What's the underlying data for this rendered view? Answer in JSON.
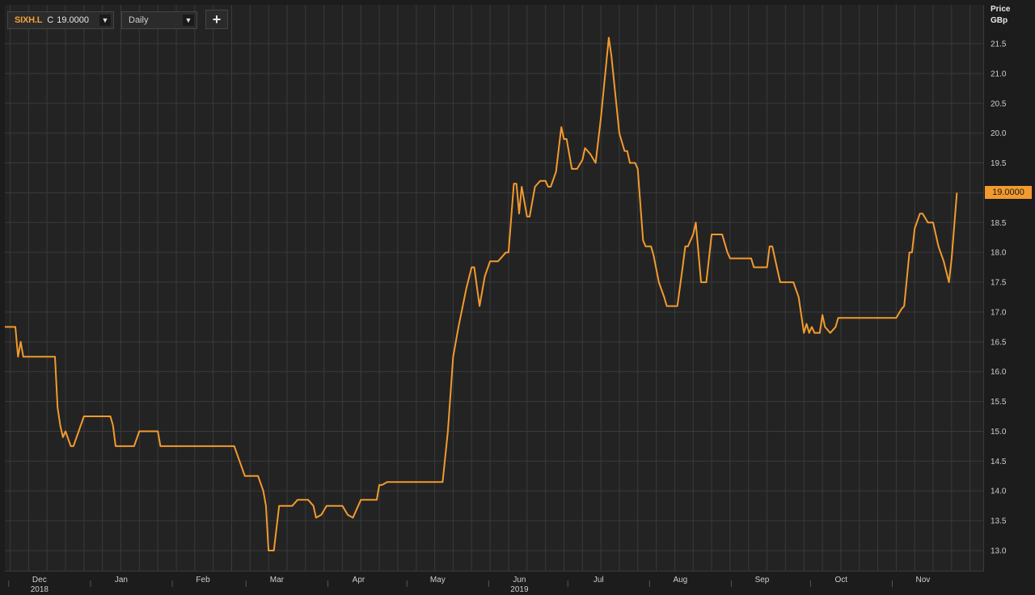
{
  "toolbar": {
    "ric": "SIXH.L",
    "close_prefix": "C",
    "close_value": "19.0000",
    "interval": "Daily",
    "add_label": "+"
  },
  "axis": {
    "title_line1": "Price",
    "title_line2": "GBp",
    "last_price_label": "19.0000"
  },
  "colors": {
    "line": "#f29a2e",
    "background": "#1c1c1c",
    "plot_background": "#232323",
    "grid": "#3a3a3a"
  },
  "icons": {
    "ric_dropdown": "triangle-down-icon",
    "interval_dropdown": "triangle-down-icon",
    "add": "plus-icon"
  },
  "chart_data": {
    "type": "line",
    "title": "",
    "xlabel": "",
    "ylabel": "Price GBp",
    "ylim": [
      12.7,
      22.1
    ],
    "yticks": [
      13.0,
      13.5,
      14.0,
      14.5,
      15.0,
      15.5,
      16.0,
      16.5,
      17.0,
      17.5,
      18.0,
      18.5,
      19.0,
      19.5,
      20.0,
      20.5,
      21.0,
      21.5
    ],
    "ytick_labels": [
      "13.0",
      "13.5",
      "14.0",
      "14.5",
      "15.0",
      "15.5",
      "16.0",
      "16.5",
      "17.0",
      "17.5",
      "18.0",
      "18.5",
      "19.0",
      "19.5",
      "20.0",
      "20.5",
      "21.0",
      "21.5"
    ],
    "x_start": "2018-11-24",
    "x_end": "2019-11-30",
    "grid": true,
    "month_labels": [
      {
        "label": "Dec",
        "date": "2018-12-01"
      },
      {
        "label": "Jan",
        "date": "2019-01-01"
      },
      {
        "label": "Feb",
        "date": "2019-02-01"
      },
      {
        "label": "Mar",
        "date": "2019-03-01"
      },
      {
        "label": "Apr",
        "date": "2019-04-01"
      },
      {
        "label": "May",
        "date": "2019-05-01"
      },
      {
        "label": "Jun",
        "date": "2019-06-01"
      },
      {
        "label": "Jul",
        "date": "2019-07-01"
      },
      {
        "label": "Aug",
        "date": "2019-08-01"
      },
      {
        "label": "Sep",
        "date": "2019-09-01"
      },
      {
        "label": "Oct",
        "date": "2019-10-01"
      },
      {
        "label": "Nov",
        "date": "2019-11-01"
      }
    ],
    "year_labels": [
      {
        "label": "2018",
        "date": "2018-12-01"
      },
      {
        "label": "2019",
        "date": "2019-06-01"
      }
    ],
    "series": [
      {
        "values": [
          [
            "2018-11-24",
            16.75
          ],
          [
            "2018-11-28",
            16.75
          ],
          [
            "2018-11-29",
            16.25
          ],
          [
            "2018-11-30",
            16.5
          ],
          [
            "2018-12-01",
            16.25
          ],
          [
            "2018-12-13",
            16.25
          ],
          [
            "2018-12-14",
            15.4
          ],
          [
            "2018-12-15",
            15.1
          ],
          [
            "2018-12-16",
            14.9
          ],
          [
            "2018-12-17",
            15.0
          ],
          [
            "2018-12-19",
            14.75
          ],
          [
            "2018-12-20",
            14.75
          ],
          [
            "2018-12-22",
            15.0
          ],
          [
            "2018-12-24",
            15.25
          ],
          [
            "2019-01-03",
            15.25
          ],
          [
            "2019-01-04",
            15.1
          ],
          [
            "2019-01-05",
            14.75
          ],
          [
            "2019-01-12",
            14.75
          ],
          [
            "2019-01-14",
            15.0
          ],
          [
            "2019-01-21",
            15.0
          ],
          [
            "2019-01-22",
            14.75
          ],
          [
            "2019-02-05",
            14.75
          ],
          [
            "2019-02-19",
            14.75
          ],
          [
            "2019-02-21",
            14.5
          ],
          [
            "2019-02-23",
            14.25
          ],
          [
            "2019-02-28",
            14.25
          ],
          [
            "2019-03-02",
            14.0
          ],
          [
            "2019-03-03",
            13.75
          ],
          [
            "2019-03-04",
            13.0
          ],
          [
            "2019-03-06",
            13.0
          ],
          [
            "2019-03-08",
            13.75
          ],
          [
            "2019-03-13",
            13.75
          ],
          [
            "2019-03-15",
            13.85
          ],
          [
            "2019-03-19",
            13.85
          ],
          [
            "2019-03-21",
            13.75
          ],
          [
            "2019-03-22",
            13.55
          ],
          [
            "2019-03-24",
            13.6
          ],
          [
            "2019-03-26",
            13.75
          ],
          [
            "2019-04-01",
            13.75
          ],
          [
            "2019-04-03",
            13.6
          ],
          [
            "2019-04-05",
            13.55
          ],
          [
            "2019-04-07",
            13.75
          ],
          [
            "2019-04-08",
            13.85
          ],
          [
            "2019-04-14",
            13.85
          ],
          [
            "2019-04-15",
            14.1
          ],
          [
            "2019-04-16",
            14.1
          ],
          [
            "2019-04-18",
            14.15
          ],
          [
            "2019-05-01",
            14.15
          ],
          [
            "2019-05-08",
            14.15
          ],
          [
            "2019-05-09",
            14.15
          ],
          [
            "2019-05-11",
            15.0
          ],
          [
            "2019-05-13",
            16.25
          ],
          [
            "2019-05-15",
            16.75
          ],
          [
            "2019-05-18",
            17.4
          ],
          [
            "2019-05-20",
            17.75
          ],
          [
            "2019-05-21",
            17.75
          ],
          [
            "2019-05-23",
            17.1
          ],
          [
            "2019-05-25",
            17.6
          ],
          [
            "2019-05-27",
            17.85
          ],
          [
            "2019-05-30",
            17.85
          ],
          [
            "2019-05-31",
            17.9
          ],
          [
            "2019-06-02",
            18.0
          ],
          [
            "2019-06-03",
            18.0
          ],
          [
            "2019-06-05",
            19.15
          ],
          [
            "2019-06-06",
            19.15
          ],
          [
            "2019-06-07",
            18.65
          ],
          [
            "2019-06-08",
            19.1
          ],
          [
            "2019-06-10",
            18.6
          ],
          [
            "2019-06-11",
            18.6
          ],
          [
            "2019-06-13",
            19.1
          ],
          [
            "2019-06-15",
            19.2
          ],
          [
            "2019-06-17",
            19.2
          ],
          [
            "2019-06-18",
            19.1
          ],
          [
            "2019-06-19",
            19.1
          ],
          [
            "2019-06-21",
            19.35
          ],
          [
            "2019-06-23",
            20.1
          ],
          [
            "2019-06-24",
            19.9
          ],
          [
            "2019-06-25",
            19.9
          ],
          [
            "2019-06-27",
            19.4
          ],
          [
            "2019-06-29",
            19.4
          ],
          [
            "2019-07-01",
            19.55
          ],
          [
            "2019-07-02",
            19.75
          ],
          [
            "2019-07-04",
            19.65
          ],
          [
            "2019-07-06",
            19.5
          ],
          [
            "2019-07-08",
            20.25
          ],
          [
            "2019-07-11",
            21.6
          ],
          [
            "2019-07-12",
            21.3
          ],
          [
            "2019-07-15",
            20.0
          ],
          [
            "2019-07-17",
            19.7
          ],
          [
            "2019-07-18",
            19.7
          ],
          [
            "2019-07-19",
            19.5
          ],
          [
            "2019-07-21",
            19.5
          ],
          [
            "2019-07-22",
            19.4
          ],
          [
            "2019-07-24",
            18.2
          ],
          [
            "2019-07-25",
            18.1
          ],
          [
            "2019-07-27",
            18.1
          ],
          [
            "2019-07-28",
            17.95
          ],
          [
            "2019-07-30",
            17.5
          ],
          [
            "2019-08-01",
            17.25
          ],
          [
            "2019-08-02",
            17.1
          ],
          [
            "2019-08-06",
            17.1
          ],
          [
            "2019-08-08",
            17.75
          ],
          [
            "2019-08-09",
            18.1
          ],
          [
            "2019-08-10",
            18.1
          ],
          [
            "2019-08-12",
            18.3
          ],
          [
            "2019-08-13",
            18.5
          ],
          [
            "2019-08-15",
            17.5
          ],
          [
            "2019-08-17",
            17.5
          ],
          [
            "2019-08-19",
            18.3
          ],
          [
            "2019-08-23",
            18.3
          ],
          [
            "2019-08-25",
            18.0
          ],
          [
            "2019-08-26",
            17.9
          ],
          [
            "2019-09-02",
            17.9
          ],
          [
            "2019-09-03",
            17.9
          ],
          [
            "2019-09-04",
            17.75
          ],
          [
            "2019-09-09",
            17.75
          ],
          [
            "2019-09-10",
            18.1
          ],
          [
            "2019-09-11",
            18.1
          ],
          [
            "2019-09-13",
            17.7
          ],
          [
            "2019-09-14",
            17.5
          ],
          [
            "2019-09-19",
            17.5
          ],
          [
            "2019-09-21",
            17.25
          ],
          [
            "2019-09-23",
            16.65
          ],
          [
            "2019-09-24",
            16.8
          ],
          [
            "2019-09-25",
            16.65
          ],
          [
            "2019-09-26",
            16.75
          ],
          [
            "2019-09-27",
            16.65
          ],
          [
            "2019-09-29",
            16.65
          ],
          [
            "2019-09-30",
            16.95
          ],
          [
            "2019-10-01",
            16.75
          ],
          [
            "2019-10-03",
            16.65
          ],
          [
            "2019-10-05",
            16.75
          ],
          [
            "2019-10-06",
            16.9
          ],
          [
            "2019-10-28",
            16.9
          ],
          [
            "2019-10-30",
            17.05
          ],
          [
            "2019-10-31",
            17.1
          ],
          [
            "2019-11-02",
            18.0
          ],
          [
            "2019-11-03",
            18.0
          ],
          [
            "2019-11-04",
            18.4
          ],
          [
            "2019-11-06",
            18.65
          ],
          [
            "2019-11-07",
            18.65
          ],
          [
            "2019-11-09",
            18.5
          ],
          [
            "2019-11-11",
            18.5
          ],
          [
            "2019-11-13",
            18.1
          ],
          [
            "2019-11-15",
            17.85
          ],
          [
            "2019-11-17",
            17.5
          ],
          [
            "2019-11-18",
            17.9
          ],
          [
            "2019-11-20",
            19.0
          ]
        ]
      }
    ]
  }
}
